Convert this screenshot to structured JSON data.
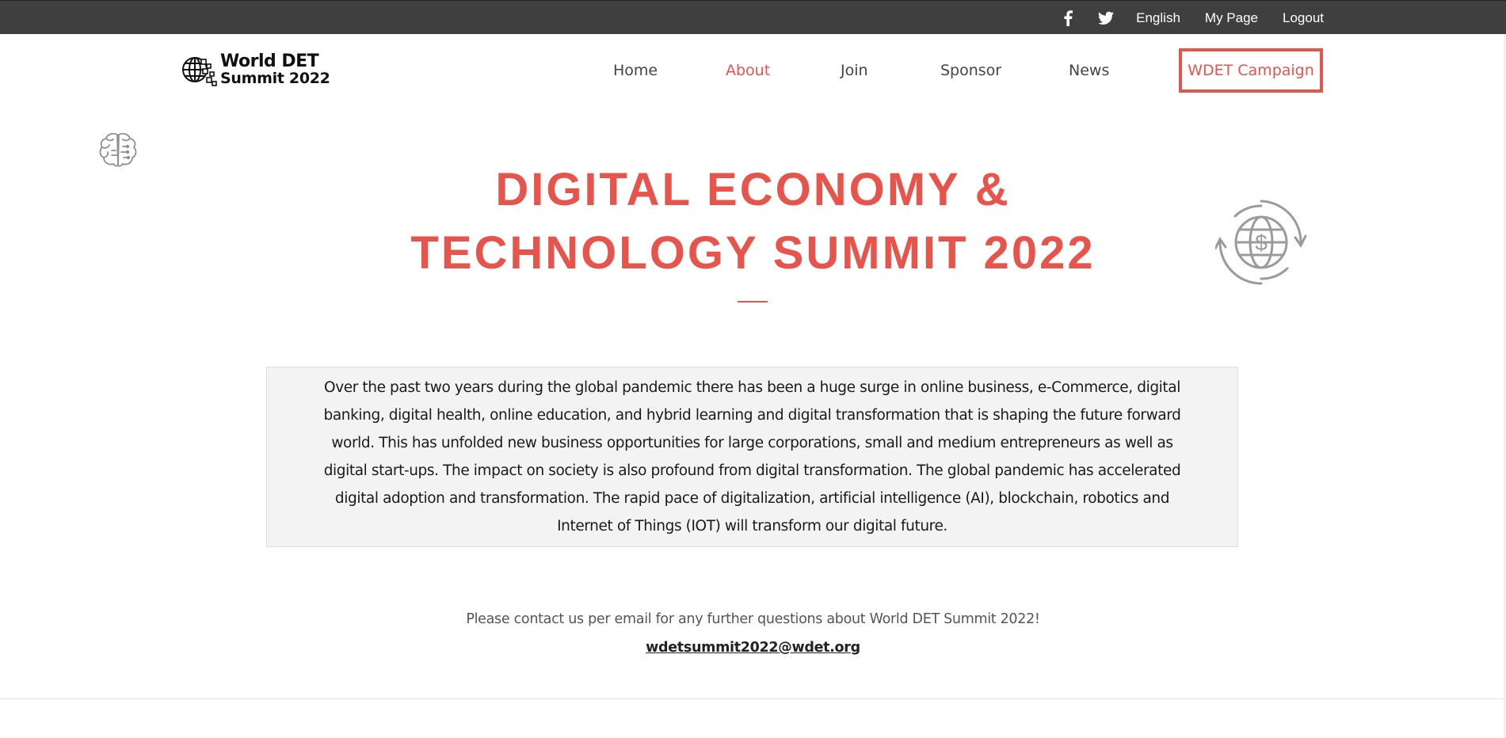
{
  "topbar": {
    "social": [
      {
        "icon": "facebook-icon"
      },
      {
        "icon": "twitter-icon"
      }
    ],
    "links": [
      "English",
      "My Page",
      "Logout"
    ]
  },
  "logo": {
    "line1": "World DET",
    "line2": "Summit 2022"
  },
  "nav": {
    "items": [
      {
        "label": "Home",
        "active": false
      },
      {
        "label": "About",
        "active": true
      },
      {
        "label": "Join",
        "active": false
      },
      {
        "label": "Sponsor",
        "active": false
      },
      {
        "label": "News",
        "active": false
      }
    ],
    "cta": "WDET Campaign"
  },
  "hero": {
    "line1": "DIGITAL ECONOMY &",
    "line2": "TECHNOLOGY SUMMIT 2022"
  },
  "description": "Over the past two years during the global pandemic there has been a huge surge in online business, e-Commerce, digital banking, digital health, online education, and hybrid learning and digital transformation that is shaping the future forward world. This has unfolded new business opportunities for large corporations, small and medium entrepreneurs as well as digital start-ups. The impact on society is also profound from digital transformation. The global pandemic has accelerated digital adoption and transformation. The rapid pace of digitalization, artificial intelligence (AI), blockchain, robotics and Internet of Things (IOT) will transform our digital future.",
  "contact": {
    "text": "Please contact us per email for any further questions about World DET Summit 2022!",
    "email": "wdetsummit2022@wdet.org"
  },
  "colors": {
    "accent": "#e6544b",
    "topbar": "#3f3f3f",
    "box_bg": "#f3f3f3"
  }
}
